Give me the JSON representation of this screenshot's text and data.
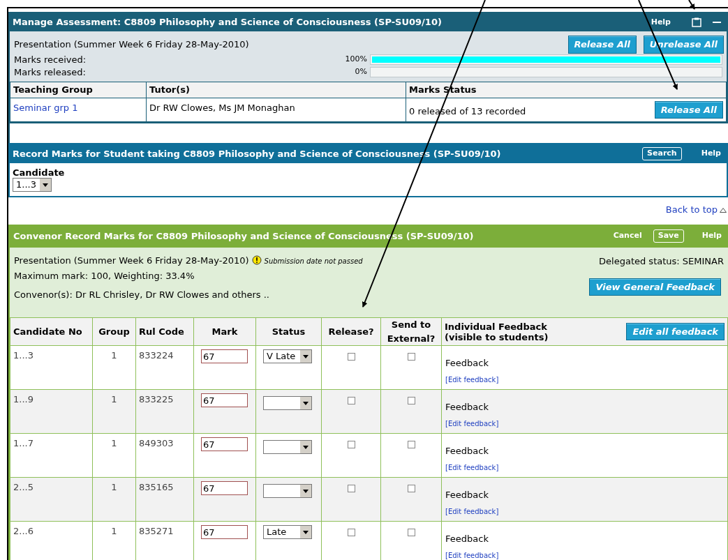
{
  "manage": {
    "title": "Manage Assessment: C8809 Philosophy and Science of Consciousness (SP-SU09/10)",
    "help": "Help",
    "presentation": "Presentation (Summer Week 6 Friday 28-May-2010)",
    "buttons": [
      "Release All",
      "Unrelease All"
    ],
    "meters": [
      {
        "label": "Marks received:",
        "reading": "100%",
        "level": 1
      },
      {
        "label": "Marks released:",
        "reading": "0%"
      }
    ],
    "columns": [
      "Teaching Group",
      "Tutor(s)",
      "Marks Status"
    ],
    "rows": [
      {
        "group": "Seminar grp 1",
        "tutors": "Dr RW Clowes, Ms JM Monaghan",
        "status": "0 released of 13 recorded",
        "button": "Release All"
      }
    ]
  },
  "record": {
    "title": "Record Marks for Student taking C8809 Philosophy and Science of Consciousness (SP-SU09/10)",
    "search": "Search",
    "help": "Help",
    "candidate_label": "Candidate",
    "candidate_value": "1...3"
  },
  "back_to_top": "Back to top",
  "convenor": {
    "title": "Convenor Record Marks for C8809 Philosophy and Science of Consciousness (SP-SU09/10)",
    "cancel": "Cancel",
    "save": "Save",
    "help": "Help",
    "presentation": "Presentation (Summer Week 6 Friday 28-May-2010)",
    "warning": "Submission date not passed",
    "delegated": "Delegated status: SEMINAR",
    "max_mark": "Maximum mark: 100, Weighting: 33.4%",
    "convenors": "Convenor(s): Dr RL Chrisley, Dr RW Clowes and others ..",
    "general_feedback": "View General Feedback",
    "columns": [
      "Candidate No",
      "Group",
      "Rul Code",
      "Mark",
      "Status",
      "Release?",
      "Send to External?",
      "Individual Feedback (visible to students)"
    ],
    "edit_all": "Edit all feedback",
    "rows": [
      {
        "candidate": "1...3",
        "group": "1",
        "code": "833224",
        "mark": "67",
        "status": "V Late",
        "release": false,
        "external": false,
        "feedback": "Feedback",
        "edit": "[Edit feedback]"
      },
      {
        "candidate": "1...9",
        "group": "1",
        "code": "833225",
        "mark": "67",
        "release": false,
        "external": false,
        "feedback": "Feedback",
        "edit": "[Edit feedback]"
      },
      {
        "candidate": "1...7",
        "group": "1",
        "code": "849303",
        "mark": "67",
        "release": false,
        "external": false,
        "feedback": "Feedback",
        "edit": "[Edit feedback]"
      },
      {
        "candidate": "2...5",
        "group": "1",
        "code": "835165",
        "mark": "67",
        "release": false,
        "external": false,
        "feedback": "Feedback",
        "edit": "[Edit feedback]"
      },
      {
        "candidate": "2...6",
        "group": "1",
        "code": "835271",
        "mark": "67",
        "status": "Late",
        "release": false,
        "external": false,
        "feedback": "Feedback",
        "edit": "[Edit feedback]"
      }
    ]
  }
}
